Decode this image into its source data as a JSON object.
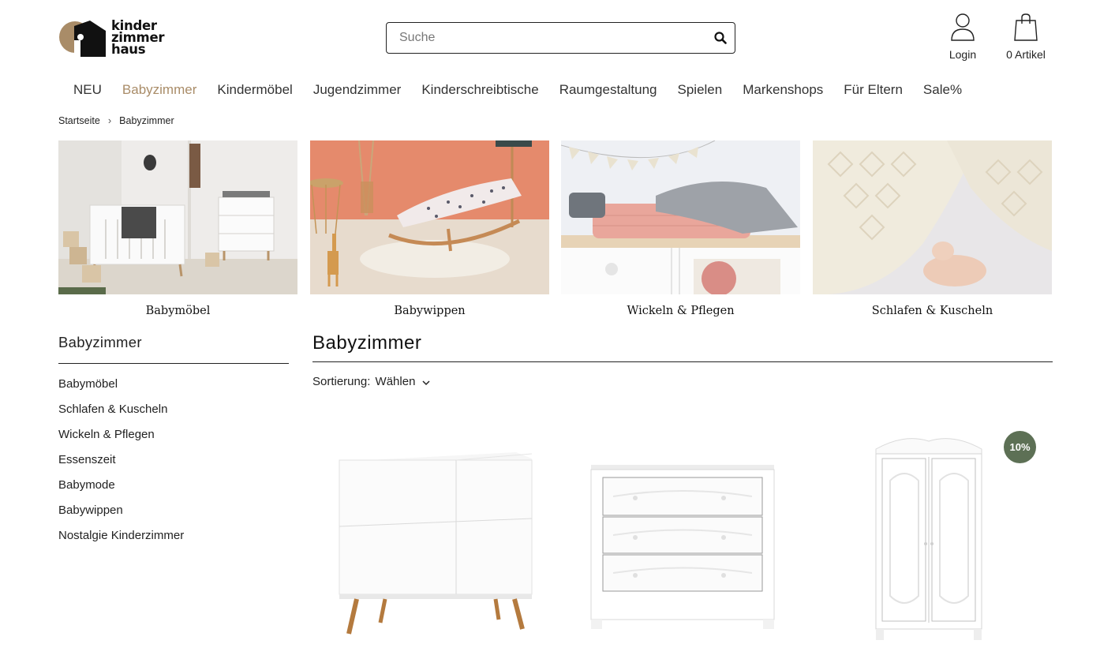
{
  "header": {
    "logo_lines": [
      "kinder",
      "zimmer",
      "haus"
    ],
    "search_placeholder": "Suche",
    "login_label": "Login",
    "cart_label": "0 Artikel"
  },
  "nav": {
    "items": [
      "NEU",
      "Babyzimmer",
      "Kindermöbel",
      "Jugendzimmer",
      "Kinderschreibtische",
      "Raumgestaltung",
      "Spielen",
      "Markenshops",
      "Für Eltern",
      "Sale%"
    ],
    "active": "Babyzimmer"
  },
  "breadcrumb": [
    "Startseite",
    "Babyzimmer"
  ],
  "tiles": [
    {
      "caption": "Babymöbel"
    },
    {
      "caption": "Babywippen"
    },
    {
      "caption": "Wickeln & Pflegen"
    },
    {
      "caption": "Schlafen & Kuscheln"
    }
  ],
  "sidebar": {
    "title": "Babyzimmer",
    "items": [
      "Babymöbel",
      "Schlafen & Kuscheln",
      "Wickeln & Pflegen",
      "Essenszeit",
      "Babymode",
      "Babywippen",
      "Nostalgie Kinderzimmer"
    ]
  },
  "main": {
    "title": "Babyzimmer",
    "sort_label": "Sortierung:",
    "sort_value": "Wählen"
  },
  "products": [
    {
      "kind": "sideboard",
      "badge": ""
    },
    {
      "kind": "dresser",
      "badge": ""
    },
    {
      "kind": "wardrobe",
      "badge": "10%"
    }
  ],
  "colors": {
    "accent": "#a98c68",
    "badge": "#5d7055",
    "text": "#222222"
  }
}
